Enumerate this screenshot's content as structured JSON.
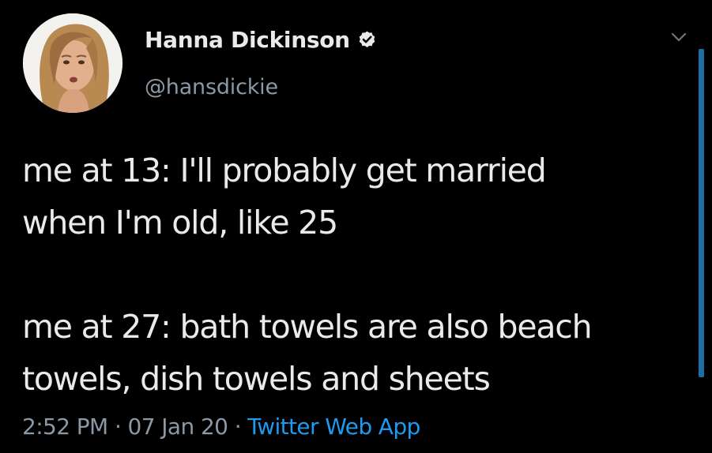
{
  "author": {
    "display_name": "Hanna Dickinson",
    "handle": "@hansdickie",
    "verified_icon": "verified-badge-icon",
    "avatar_icon": "profile-photo"
  },
  "tweet": {
    "lines": [
      "me at 13: I'll probably get married",
      "when I'm old, like 25",
      "me at 27: bath towels are also beach",
      "towels, dish towels and sheets"
    ]
  },
  "meta": {
    "time": "2:52 PM",
    "separator": "·",
    "date": "07 Jan 20",
    "source": "Twitter Web App"
  },
  "colors": {
    "background": "#000000",
    "text": "#e9eaeb",
    "secondary": "#8b98a5",
    "accent": "#1d9bf0",
    "scrollbar": "#1c6ea4"
  },
  "icons": {
    "menu": "chevron-down-icon"
  }
}
